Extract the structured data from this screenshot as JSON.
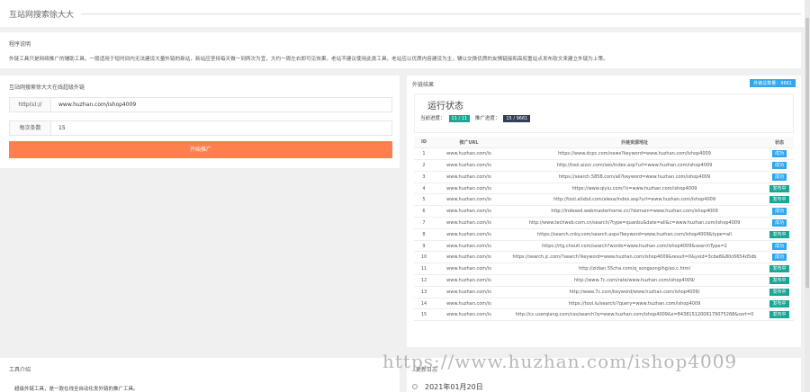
{
  "header": {
    "title": "互站网搜索徐大大"
  },
  "description": {
    "title": "程序说明",
    "text": "外链工具只是网络推广的辅助工具，一般适用于短时间内无法建设大量外链的新站，新站应坚持每天做一到两次为宜，大约一周左右即可见效果。老站不建议使用此类工具，老站应以优质内容建设为主，辅以交换优质的友情链接和高权重站点发布软文来建立外链为上策。"
  },
  "form": {
    "title": "互站网搜索徐大大在线超级外链",
    "url_label": "http(s)://",
    "url_value": "www.huzhan.com/ishop4009",
    "count_label": "每次条数",
    "count_value": "15",
    "submit_label": "开始推广"
  },
  "results": {
    "title": "外链结果",
    "total_badge": "外链总数量：9661",
    "status_title": "运行状态",
    "progress_label": "当前进度：",
    "progress_value": "11 / 11",
    "push_label": "推广进度：",
    "push_value": "15 / 9661",
    "columns": [
      "ID",
      "推广URL",
      "外链资源地址",
      "状态"
    ],
    "rows": [
      {
        "id": "1",
        "url": "www.huzhan.com/is",
        "res": "https://www.dcpc.com/news?keyword=www.huzhan.com/ishop4009",
        "st": "成功",
        "ok": true
      },
      {
        "id": "2",
        "url": "www.huzhan.com/is",
        "res": "http://tool.aizzc.com/seo/index.asp?url=www.huzhan.com/ishop4009",
        "st": "成功",
        "ok": true
      },
      {
        "id": "3",
        "url": "www.huzhan.com/is",
        "res": "https://search.5858.com/all?keyword=www.huzhan.com/ishop4009",
        "st": "成功",
        "ok": true
      },
      {
        "id": "4",
        "url": "www.huzhan.com/is",
        "res": "https://www.qiyiu.com/?s=www.huzhan.com/ishop4009",
        "st": "发布中",
        "ok": false
      },
      {
        "id": "5",
        "url": "www.huzhan.com/is",
        "res": "http://tool.alixbd.com/alexa/index.asp?url=www.huzhan.com/ishop4009",
        "st": "发布中",
        "ok": false
      },
      {
        "id": "6",
        "url": "www.huzhan.com/is",
        "res": "http://indexed.webmasterhome.cn/?domain=www.huzhan.com/ishop4009",
        "st": "成功",
        "ok": true
      },
      {
        "id": "7",
        "url": "www.huzhan.com/is",
        "res": "http://www.techweb.com.cn/search/?type=quanbu&date=all&c=www.huzhan.com/ishop4009",
        "st": "成功",
        "ok": true
      },
      {
        "id": "8",
        "url": "www.huzhan.com/is",
        "res": "https://search.cnky.com/search.aspx?keyword=www.huzhan.com/ishop4009&type=all",
        "st": "发布中",
        "ok": false
      },
      {
        "id": "9",
        "url": "www.huzhan.com/is",
        "res": "https://rtg.chouti.com/search?words=www.huzhan.com/ishop4009&searchType=2",
        "st": "成功",
        "ok": true
      },
      {
        "id": "10",
        "url": "www.huzhan.com/is",
        "res": "https://search.jc.com/?search?keyword=www.huzhan.com/ishop4009&result=0&yxid=3cbe8&80c6654d5db",
        "st": "成功",
        "ok": true
      },
      {
        "id": "11",
        "url": "www.huzhan.com/is",
        "res": "http://zidian.55cha.com/q_songsong/hg/ao.c.html",
        "st": "发布中",
        "ok": false
      },
      {
        "id": "12",
        "url": "www.huzhan.com/is",
        "res": "http://www.7c.com/rate/www.huzhan.com/ishop4009/",
        "st": "发布中",
        "ok": false
      },
      {
        "id": "13",
        "url": "www.huzhan.com/is",
        "res": "http://www.7c.com/keyword/www.huzhan.com/ishop4009/",
        "st": "发布中",
        "ok": false
      },
      {
        "id": "14",
        "url": "www.huzhan.com/is",
        "res": "https://tool.lu/search/?query=www.huzhan.com/ishop4009",
        "st": "发布中",
        "ok": false
      },
      {
        "id": "15",
        "url": "www.huzhan.com/is",
        "res": "http://cc.userqiang.com/css/search?q=www.huzhan.com/ishop4009&s=84381512008179075268&sort=0",
        "st": "发布中",
        "ok": false
      }
    ]
  },
  "tools": {
    "title": "工具介绍",
    "text": "超级外链工具，是一款在线全自动化发外链的推广工具。"
  },
  "updates": {
    "title": "更新日志",
    "date": "2021年01月20日"
  },
  "watermark": "https://www.huzhan.com/ishop4009",
  "colors": {
    "accent": "#ff7f4e",
    "blue": "#2da7f0",
    "success": "#2da7f0",
    "publishing": "#1aa594",
    "dark": "#2f4056"
  }
}
